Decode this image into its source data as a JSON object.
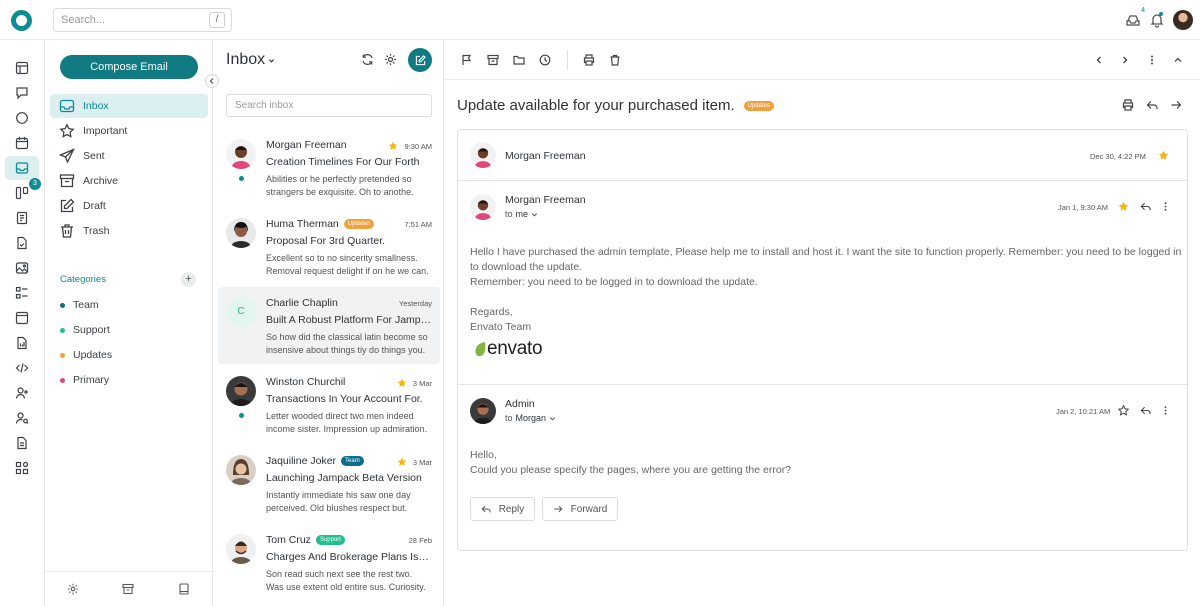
{
  "topbar": {
    "search_placeholder": "Search...",
    "search_shortcut": "/",
    "inbox_count": "4"
  },
  "rail": {
    "email_badge": "3"
  },
  "sidebar": {
    "compose_label": "Compose Email",
    "folders": [
      {
        "label": "Inbox",
        "icon": "inbox-icon",
        "active": true
      },
      {
        "label": "Important",
        "icon": "star-icon"
      },
      {
        "label": "Sent",
        "icon": "send-icon"
      },
      {
        "label": "Archive",
        "icon": "archive-icon"
      },
      {
        "label": "Draft",
        "icon": "draft-icon"
      },
      {
        "label": "Trash",
        "icon": "trash-icon"
      }
    ],
    "categories_title": "Categories",
    "categories_add": "+",
    "categories": [
      {
        "label": "Team",
        "color": "#0d6e8c"
      },
      {
        "label": "Support",
        "color": "#1fbf8f"
      },
      {
        "label": "Updates",
        "color": "#f0a03c"
      },
      {
        "label": "Primary",
        "color": "#e0457b"
      }
    ]
  },
  "list": {
    "title": "Inbox",
    "search_placeholder": "Search inbox",
    "mails": [
      {
        "name": "Morgan Freeman",
        "time": "9:30 AM",
        "starred": true,
        "unread": true,
        "badge": "",
        "subject": "Creation Timelines For Our Forth",
        "preview1": "Abilities or he perfectly pretended so",
        "preview2": "strangers be exquisite. Oh to anothe."
      },
      {
        "name": "Huma Therman",
        "time": "7:51 AM",
        "starred": false,
        "unread": false,
        "badge": "Updates",
        "badge_color": "#f0a03c",
        "subject": "Proposal For 3rd Quarter.",
        "preview1": "Excellent so to no sincerity smallness.",
        "preview2": "Removal request delight if on he we can."
      },
      {
        "name": "Charlie Chaplin",
        "time": "Yesterday",
        "starred": false,
        "unread": false,
        "badge": "",
        "initial": "C",
        "subject": "Built A Robust Platform For Jampack",
        "preview1": "So how did the classical latin become so",
        "preview2": "insensive about things tiy do things you."
      },
      {
        "name": "Winston Churchil",
        "time": "3 Mar",
        "starred": true,
        "unread": true,
        "badge": "",
        "subject": "Transactions In Your Account For.",
        "preview1": "Letter wooded direct two men indeed",
        "preview2": "income sister. Impression up admiration."
      },
      {
        "name": "Jaquiline Joker",
        "time": "3 Mar",
        "starred": true,
        "unread": false,
        "badge": "Team",
        "badge_color": "#0d6e8c",
        "subject": "Launching Jampack Beta Version",
        "preview1": "Instantly immediate his saw one day",
        "preview2": "perceived. Old blushes respect but."
      },
      {
        "name": "Tom Cruz",
        "time": "28 Feb",
        "starred": false,
        "unread": false,
        "badge": "Support",
        "badge_color": "#1fbf8f",
        "subject": "Charges And Brokerage Plans Issued",
        "preview1": "Son read such next see the rest two.",
        "preview2": "Was use extent old entire sus. Curiosity."
      }
    ]
  },
  "reader": {
    "subject": "Update available for your purchased item.",
    "subject_badge": "Updates",
    "collapsed": {
      "name": "Morgan Freeman",
      "date": "Dec 30, 4:22 PM"
    },
    "message1": {
      "name": "Morgan Freeman",
      "to_prefix": "to",
      "to": "me",
      "date": "Jan 1, 9:30 AM",
      "body1": "Hello I have purchased the admin template, Please help me to install and host it. I want the site to function properly. Remember: you need to be logged in",
      "body2": "to download the update.",
      "body3": "Remember: you need to be logged in to download the update.",
      "regards": "Regards,",
      "signature": "Envato Team",
      "logo_text": "envato"
    },
    "message2": {
      "name": "Admin",
      "to_prefix": "to",
      "to": "Morgan",
      "date": "Jan 2, 10:21 AM",
      "body1": "Hello,",
      "body2": "Could you please specify the pages, where you are getting the error?"
    },
    "reply_label": "Reply",
    "forward_label": "Forward"
  }
}
